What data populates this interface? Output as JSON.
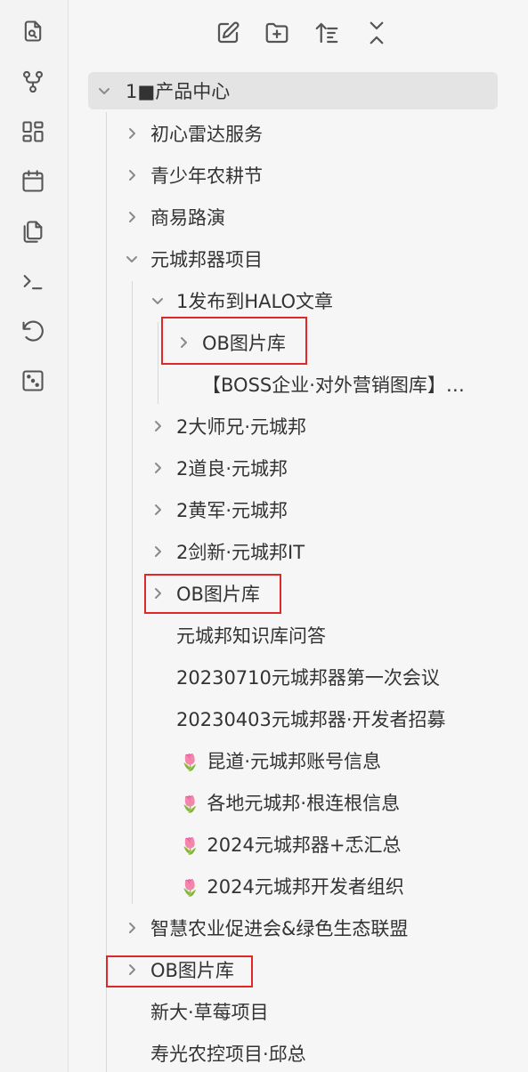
{
  "ribbon": {
    "items": [
      {
        "icon": "file-search-icon"
      },
      {
        "icon": "git-branch-icon"
      },
      {
        "icon": "layout-grid-icon"
      },
      {
        "icon": "calendar-icon"
      },
      {
        "icon": "copy-pages-icon"
      },
      {
        "icon": "terminal-icon"
      },
      {
        "icon": "history-undo-icon"
      },
      {
        "icon": "dice-random-icon"
      }
    ]
  },
  "toolbar": {
    "items": [
      {
        "icon": "new-note-icon"
      },
      {
        "icon": "new-folder-icon"
      },
      {
        "icon": "sort-order-icon"
      },
      {
        "icon": "collapse-all-icon"
      }
    ]
  },
  "tree": {
    "root": "1■产品中心",
    "items": [
      {
        "label": "初心雷达服务"
      },
      {
        "label": "青少年农耕节"
      },
      {
        "label": "商易路演"
      },
      {
        "label": "元城邦器项目"
      },
      {
        "label": "1发布到HALO文章"
      },
      {
        "label": "OB图片库"
      },
      {
        "label": "【BOSS企业·对外营销图库】…"
      },
      {
        "label": "2大师兄·元城邦"
      },
      {
        "label": "2道良·元城邦"
      },
      {
        "label": "2黄军·元城邦"
      },
      {
        "label": "2剑新·元城邦IT"
      },
      {
        "label": "OB图片库"
      },
      {
        "label": "元城邦知识库问答"
      },
      {
        "label": "20230710元城邦器第一次会议"
      },
      {
        "label": "20230403元城邦器·开发者招募"
      },
      {
        "label": "昆道·元城邦账号信息",
        "emoji": "🌷"
      },
      {
        "label": "各地元城邦·根连根信息",
        "emoji": "🌷"
      },
      {
        "label": "2024元城邦器+忎汇总",
        "emoji": "🌷"
      },
      {
        "label": "2024元城邦开发者组织",
        "emoji": "🌷"
      },
      {
        "label": "智慧农业促进会&绿色生态联盟"
      },
      {
        "label": "OB图片库"
      },
      {
        "label": "新大·草莓项目"
      },
      {
        "label": "寿光农控项目·邱总"
      }
    ]
  },
  "colors": {
    "highlight": "#e02828",
    "root_bg": "#e4e4e4",
    "background": "#f6f6f6"
  }
}
